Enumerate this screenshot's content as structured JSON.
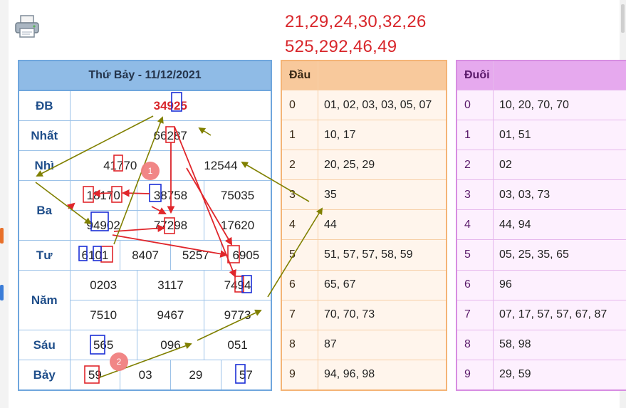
{
  "prediction": {
    "line1": "21,29,24,30,32,26",
    "line2": "525,292,46,49"
  },
  "result_table": {
    "header": "Thứ Bảy - 11/12/2021",
    "rows": {
      "db": {
        "label": "ĐB",
        "values": [
          "34925"
        ]
      },
      "nhat": {
        "label": "Nhất",
        "values": [
          "66287"
        ]
      },
      "nhi": {
        "label": "Nhì",
        "values": [
          "41770",
          "12544"
        ]
      },
      "ba": {
        "label": "Ba",
        "values": [
          "18170",
          "38758",
          "75035",
          "94902",
          "77298",
          "17620"
        ]
      },
      "tu": {
        "label": "Tư",
        "values": [
          "6101",
          "8407",
          "5257",
          "6905"
        ]
      },
      "nam": {
        "label": "Năm",
        "values": [
          "0203",
          "3117",
          "7494",
          "7510",
          "9467",
          "9773"
        ]
      },
      "sau": {
        "label": "Sáu",
        "values": [
          "565",
          "096",
          "051"
        ]
      },
      "bay": {
        "label": "Bảy",
        "values": [
          "59",
          "03",
          "29",
          "57"
        ]
      }
    }
  },
  "dau_table": {
    "header": "Đầu",
    "rows": [
      {
        "k": "0",
        "v": "01, 02, 03, 03, 05, 07"
      },
      {
        "k": "1",
        "v": "10, 17"
      },
      {
        "k": "2",
        "v": "20, 25, 29"
      },
      {
        "k": "3",
        "v": "35"
      },
      {
        "k": "4",
        "v": "44"
      },
      {
        "k": "5",
        "v": "51, 57, 57, 58, 59"
      },
      {
        "k": "6",
        "v": "65, 67"
      },
      {
        "k": "7",
        "v": "70, 70, 73"
      },
      {
        "k": "8",
        "v": "87"
      },
      {
        "k": "9",
        "v": "94, 96, 98"
      }
    ]
  },
  "duoi_table": {
    "header": "Đuôi",
    "rows": [
      {
        "k": "0",
        "v": "10, 20, 70, 70"
      },
      {
        "k": "1",
        "v": "01, 51"
      },
      {
        "k": "2",
        "v": "02"
      },
      {
        "k": "3",
        "v": "03, 03, 73"
      },
      {
        "k": "4",
        "v": "44, 94"
      },
      {
        "k": "5",
        "v": "05, 25, 35, 65"
      },
      {
        "k": "6",
        "v": "96"
      },
      {
        "k": "7",
        "v": "07, 17, 57, 57, 67, 87"
      },
      {
        "k": "8",
        "v": "58, 98"
      },
      {
        "k": "9",
        "v": "29, 59"
      }
    ]
  },
  "annotations": {
    "badge1": "1",
    "badge2": "2"
  },
  "colors": {
    "prediction": "#d8262b",
    "red_marker": "#e0262b",
    "blue_marker": "#1b2fd6",
    "olive_arrow": "#808000",
    "badge": "#f08080"
  },
  "icons": {
    "printer": "printer-icon"
  }
}
